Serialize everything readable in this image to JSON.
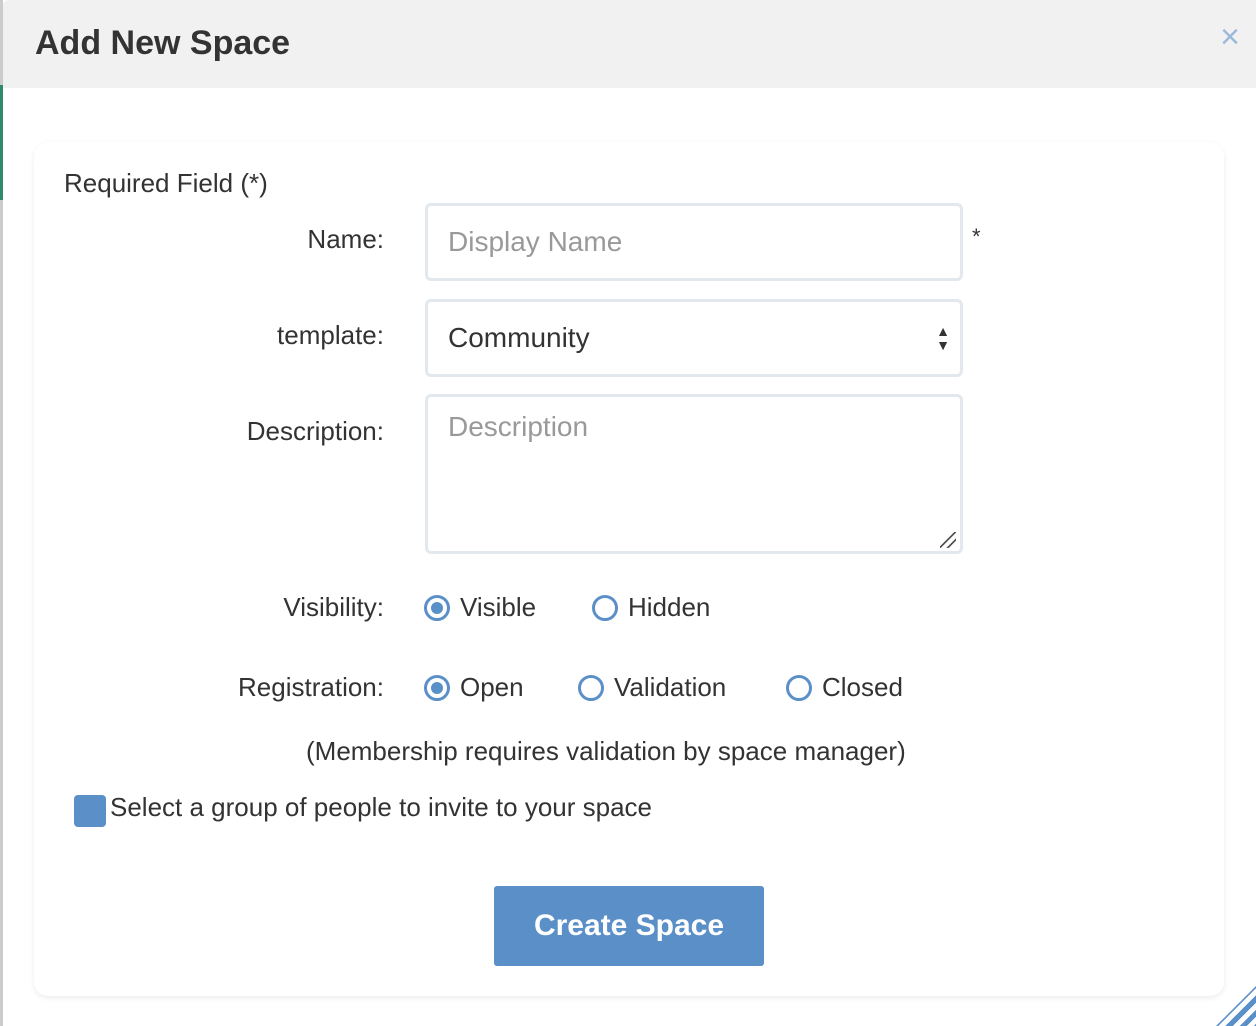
{
  "dialog": {
    "title": "Add New Space",
    "close_icon": "close-icon"
  },
  "form": {
    "required_note": "Required Field (*)",
    "name": {
      "label": "Name:",
      "placeholder": "Display Name",
      "required_mark": "*"
    },
    "template": {
      "label": "template:",
      "value": "Community",
      "arrows": "▲▼"
    },
    "description": {
      "label": "Description:",
      "placeholder": "Description"
    },
    "visibility": {
      "label": "Visibility:",
      "options": [
        "Visible",
        "Hidden"
      ],
      "selected": "Visible"
    },
    "registration": {
      "label": "Registration:",
      "options": [
        "Open",
        "Validation",
        "Closed"
      ],
      "selected": "Open",
      "note": "(Membership requires validation by space manager)"
    },
    "invite_checkbox": {
      "label": "Select a group of people to invite to your space"
    },
    "submit": "Create Space"
  }
}
